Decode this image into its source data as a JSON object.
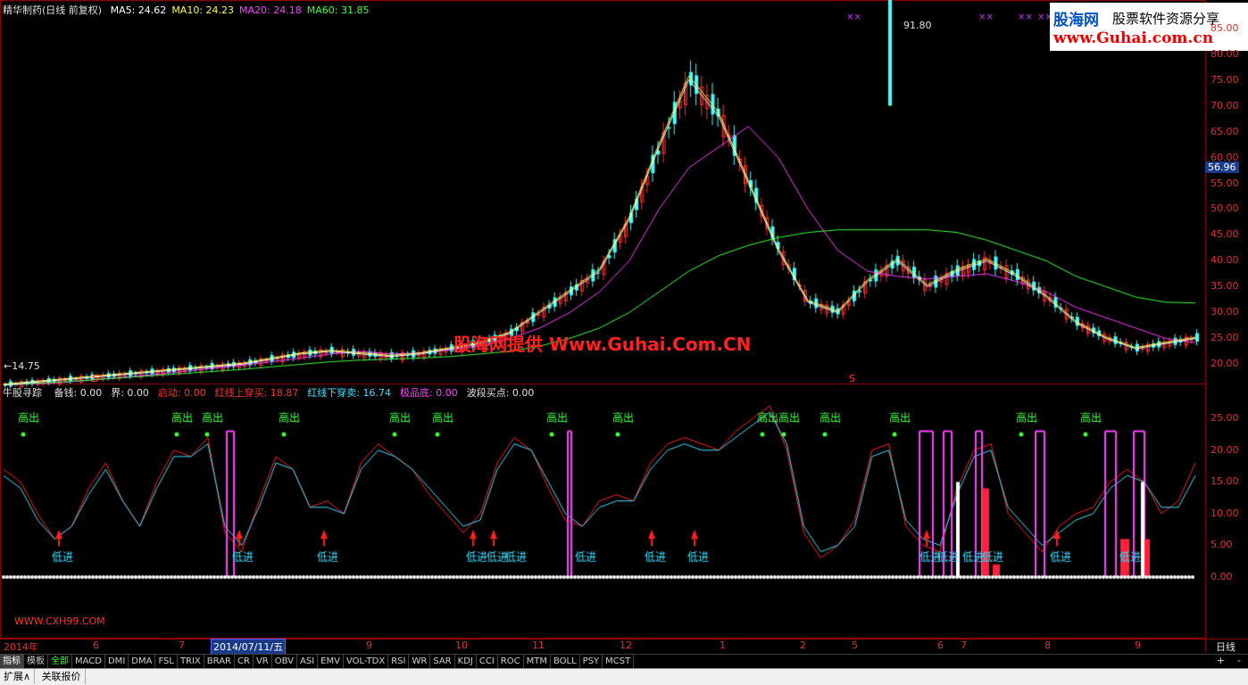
{
  "header": {
    "title": "精华制药(日线 前复权)",
    "ma_items": [
      {
        "label": "MA5: 24.62",
        "color": "#ffffff"
      },
      {
        "label": "MA10: 24.23",
        "color": "#ffff40"
      },
      {
        "label": "MA20: 24.18",
        "color": "#ff40ff"
      },
      {
        "label": "MA60: 31.85",
        "color": "#40ff40"
      }
    ]
  },
  "watermark": {
    "brand": "股海网",
    "slogan": "股票软件资源分享",
    "url": "www.Guhai.com.cn"
  },
  "center_watermark": "股海网提供 Www.Guhai.Com.CN",
  "indicator_header": {
    "name": "牛股寻踪",
    "items": [
      {
        "label": "备钱: 0.00",
        "color": "#e0e0e0"
      },
      {
        "label": "界: 0.00",
        "color": "#e0e0e0"
      },
      {
        "label": "启动: 0.00",
        "color": "#ff3030"
      },
      {
        "label": "红线上穿买: 18.87",
        "color": "#ff3030"
      },
      {
        "label": "红线下穿卖: 16.74",
        "color": "#40e0ff"
      },
      {
        "label": "极品底: 0.00",
        "color": "#ff40ff"
      },
      {
        "label": "波段买点: 0.00",
        "color": "#e0e0e0"
      }
    ]
  },
  "price_axis": [
    "85.00",
    "80.00",
    "75.00",
    "70.00",
    "65.00",
    "60.00",
    "55.00",
    "50.00",
    "45.00",
    "40.00",
    "35.00",
    "30.00",
    "25.00",
    "20.00"
  ],
  "current_price_tag": "56.96",
  "indicator_axis": [
    "25.00",
    "20.00",
    "15.00",
    "10.00",
    "5.00",
    "0.00"
  ],
  "annotations": {
    "high": "91.80",
    "low": "14.75",
    "s_marker": "S",
    "x_marker": "××",
    "high_out": "高出",
    "low_in": "低进"
  },
  "footer_watermark": "WWW.CXH99.COM",
  "x_axis": {
    "labels": [
      "2014年",
      "6",
      "7",
      "9",
      "10",
      "11",
      "12",
      "1",
      "2",
      "5",
      "6",
      "7",
      "8",
      "9"
    ],
    "cursor_date": "2014/07/11/五",
    "period": "日线"
  },
  "indicator_tabs": [
    "指标",
    "模板",
    "全部",
    "MACD",
    "DMI",
    "DMA",
    "FSL",
    "TRIX",
    "BRAR",
    "CR",
    "VR",
    "OBV",
    "ASI",
    "EMV",
    "VOL-TDX",
    "RSI",
    "WR",
    "SAR",
    "KDJ",
    "CCI",
    "ROC",
    "MTM",
    "BOLL",
    "PSY",
    "MCST"
  ],
  "bottom_buttons": [
    "扩展∧",
    "关联报价"
  ],
  "zoom_buttons": [
    "+",
    "-"
  ],
  "chart_data": {
    "type": "line",
    "title": "精华制药(日线 前复权)",
    "price_range": [
      14.75,
      91.8
    ],
    "ylim": [
      18,
      87
    ],
    "indicator_ylim": [
      0,
      27
    ],
    "series": [
      {
        "name": "MA5",
        "color": "#ffffff",
        "values": [
          16,
          16.5,
          17,
          17.5,
          18,
          18.5,
          19,
          19.5,
          20,
          21,
          22,
          22.5,
          22,
          21.5,
          22,
          23,
          24,
          26,
          30,
          34,
          38,
          48,
          62,
          75,
          68,
          55,
          42,
          32,
          30,
          36,
          40,
          35,
          38,
          40,
          37,
          33,
          28,
          25,
          23,
          24,
          25
        ]
      },
      {
        "name": "MA60",
        "color": "#40ff40",
        "values": [
          16,
          16.3,
          16.6,
          17,
          17.4,
          17.8,
          18.2,
          18.6,
          19,
          19.5,
          20,
          20.5,
          20.8,
          21,
          21.2,
          21.5,
          22,
          22.5,
          23.5,
          25,
          27,
          30,
          34,
          38,
          41,
          43,
          44.5,
          45.5,
          46,
          46,
          46,
          46,
          45.5,
          44,
          42,
          40,
          37,
          35,
          33,
          32,
          31.85
        ]
      },
      {
        "name": "MA20",
        "color": "#ff40ff",
        "values": [
          16,
          16.2,
          16.5,
          17,
          17.5,
          18,
          18.6,
          19.2,
          19.8,
          20.5,
          21.2,
          22,
          22.5,
          22,
          22.2,
          22.8,
          23.5,
          25,
          27,
          30,
          34,
          40,
          50,
          58,
          62,
          66,
          60,
          50,
          42,
          38,
          37,
          36.5,
          37,
          37.5,
          36,
          34,
          31,
          29,
          27,
          25,
          24.18
        ]
      }
    ],
    "indicator": {
      "name": "牛股寻踪",
      "red_line": [
        17,
        15,
        10,
        6,
        8,
        14,
        18,
        12,
        8,
        15,
        20,
        19,
        22,
        7,
        4,
        12,
        19,
        17,
        11,
        12,
        10,
        18,
        21,
        19,
        17,
        13,
        10,
        7,
        10,
        18,
        22,
        20,
        14,
        9,
        8,
        12,
        13,
        12,
        18,
        21,
        22,
        21,
        20,
        23,
        25,
        27,
        20,
        7,
        3,
        5,
        9,
        20,
        21,
        8,
        5,
        4,
        14,
        20,
        21,
        10,
        7,
        4,
        8,
        10,
        11,
        15,
        17,
        15,
        10,
        12,
        18
      ],
      "cyan_line": [
        16,
        14,
        9,
        6,
        8,
        13,
        17,
        12,
        8,
        14,
        19,
        19,
        21,
        8,
        5,
        11,
        18,
        17,
        11,
        11,
        10,
        17,
        20,
        19,
        17,
        14,
        11,
        8,
        9,
        17,
        21,
        20,
        15,
        10,
        8,
        11,
        12,
        12,
        17,
        20,
        21,
        20,
        20,
        22,
        24,
        26,
        21,
        8,
        4,
        5,
        8,
        19,
        20,
        9,
        6,
        5,
        13,
        19,
        20,
        11,
        8,
        5,
        7,
        9,
        10,
        14,
        16,
        15,
        11,
        11,
        16
      ],
      "current": {
        "红线上穿买": 18.87,
        "红线下穿卖": 16.74
      }
    }
  }
}
